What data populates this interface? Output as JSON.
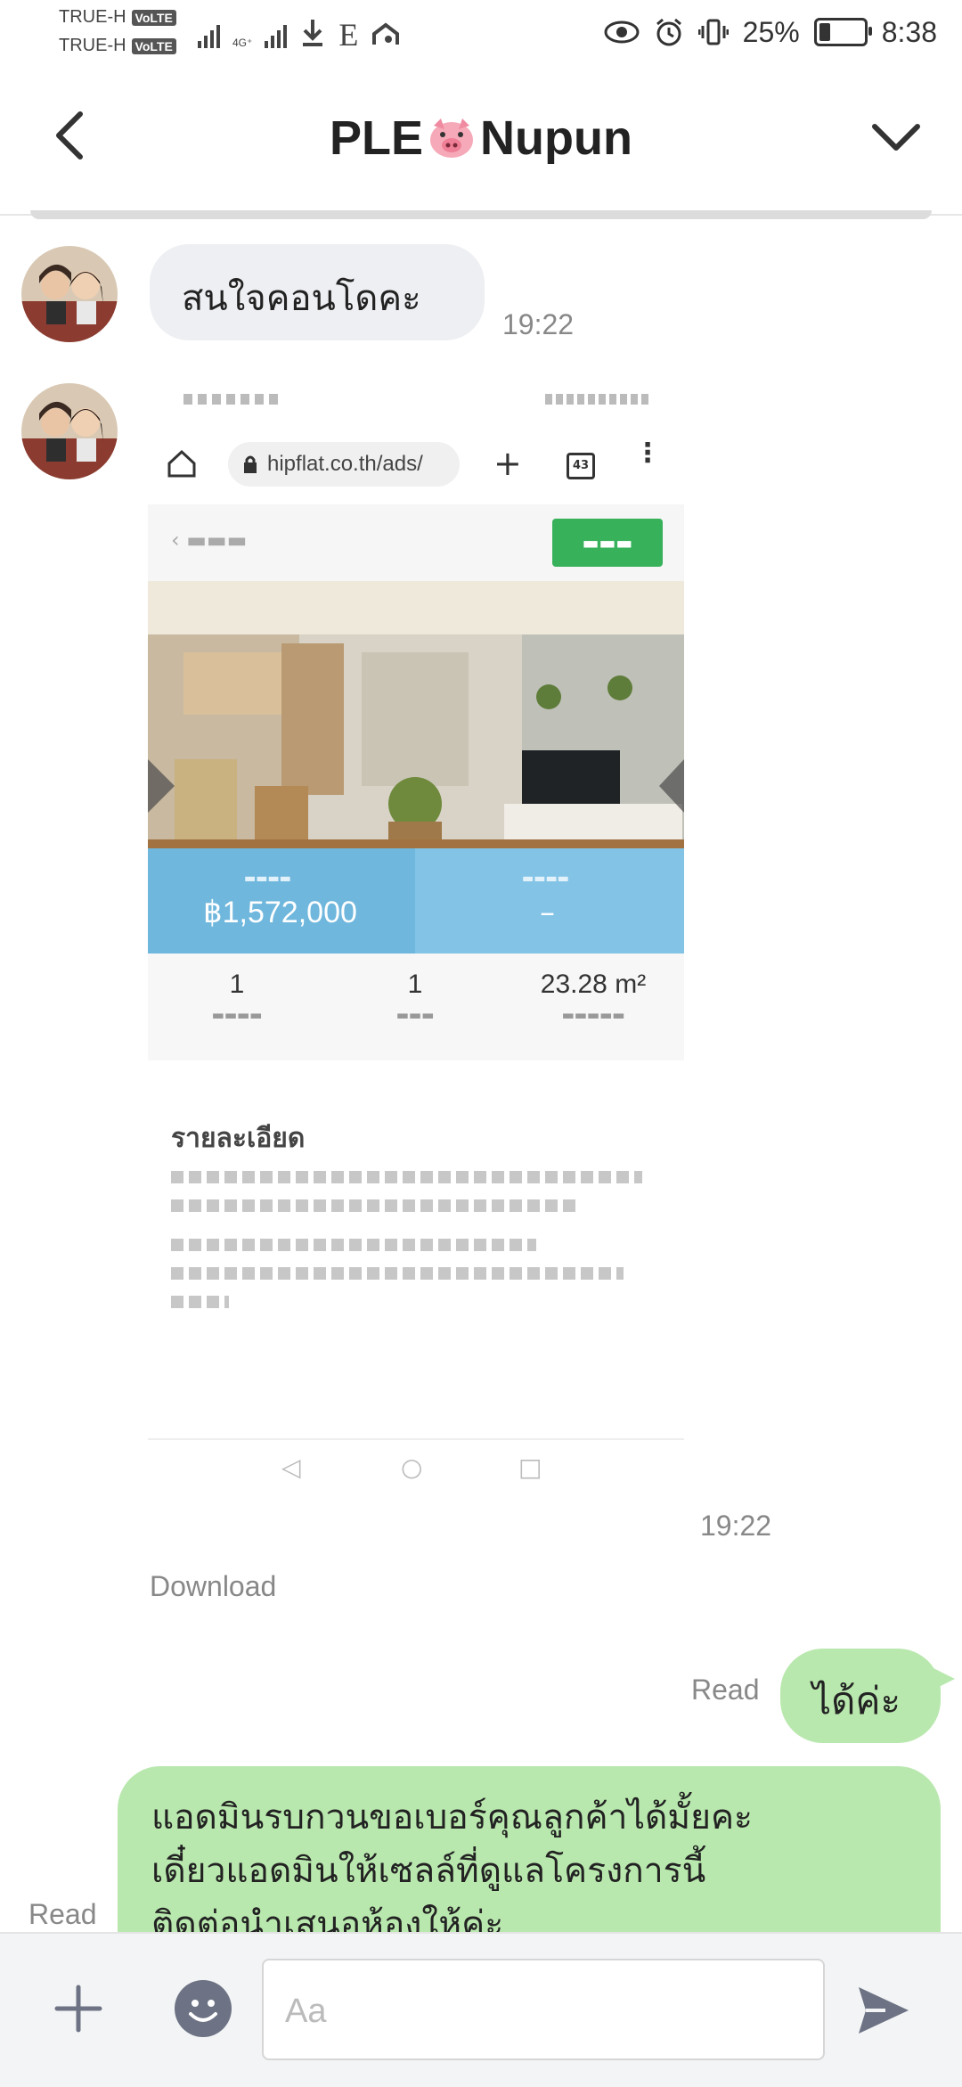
{
  "status_bar": {
    "carrier_1": "TRUE-H",
    "carrier_2": "TRUE-H",
    "volte_badge": "VoLTE",
    "network_type": "4G⁺",
    "network_sub": "⁺ E",
    "battery_level_percent": 25,
    "battery_text": "25%",
    "clock": "8:38"
  },
  "header": {
    "title_left": "PLE",
    "title_right": "Nupun"
  },
  "messages": {
    "msg1": {
      "text": "สนใจคอนโดคะ",
      "time": "19:22"
    },
    "msg2": {
      "time": "19:22",
      "download_label": "Download",
      "screenshot": {
        "url": "hipflat.co.th/ads/",
        "price": "฿1,572,000",
        "price_right": "–",
        "stats": [
          {
            "value": "1"
          },
          {
            "value": "1"
          },
          {
            "value": "23.28 m²"
          }
        ],
        "detail_title": "รายละเอียด"
      }
    },
    "msg3": {
      "text": "ได้ค่ะ",
      "status": "Read"
    },
    "msg4": {
      "line1": "แอดมินรบกวนขอเบอร์คุณลูกค้าได้มั้ยคะ",
      "line2": "เดี๋ยวแอดมินให้เซลล์ที่ดูแลโครงการนี้",
      "line3": "ติดต่อนำเสนอห้องให้ค่ะ",
      "status": "Read"
    }
  },
  "composer": {
    "placeholder": "Aa"
  },
  "colors": {
    "outgoing_bubble": "#b9e8ae",
    "incoming_bubble": "#eeeff2",
    "icon_dark": "#6d7384"
  }
}
